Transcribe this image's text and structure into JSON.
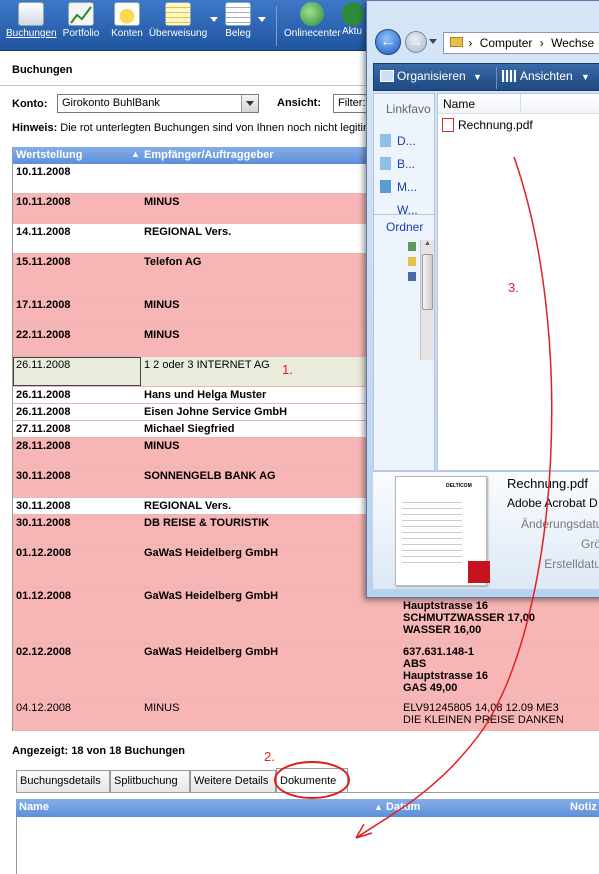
{
  "toolbar": {
    "buttons": [
      "Buchungen",
      "Portfolio",
      "Konten",
      "Überweisung",
      "Beleg",
      "Onlinecenter",
      "Aktu"
    ]
  },
  "page_title": "Buchungen",
  "konto": {
    "label": "Konto:",
    "value": "Girokonto BuhlBank"
  },
  "ansicht": {
    "label": "Ansicht:",
    "value": "Filter:"
  },
  "hint": {
    "label": "Hinweis:",
    "text": "Die rot unterlegten Buchungen sind von Ihnen noch nicht legitim"
  },
  "grid": {
    "col_wertstellung": "Wertstellung",
    "col_empfaenger": "Empfänger/Auftraggeber"
  },
  "rows": [
    {
      "date": "10.11.2008",
      "party": "",
      "extra": ""
    },
    {
      "date": "10.11.2008",
      "party": "MINUS",
      "extra": ""
    },
    {
      "date": "14.11.2008",
      "party": "REGIONAL Vers.",
      "extra": ""
    },
    {
      "date": "15.11.2008",
      "party": "Telefon AG",
      "extra": ""
    },
    {
      "date": "17.11.2008",
      "party": "MINUS",
      "extra": ""
    },
    {
      "date": "22.11.2008",
      "party": "MINUS",
      "extra": ""
    },
    {
      "date": "26.11.2008",
      "party": "1 2 oder 3 INTERNET AG",
      "extra": ""
    },
    {
      "date": "26.11.2008",
      "party": "Hans und Helga Muster",
      "extra": ""
    },
    {
      "date": "26.11.2008",
      "party": "Eisen Johne Service GmbH",
      "extra": ""
    },
    {
      "date": "27.11.2008",
      "party": "Michael Siegfried",
      "extra": ""
    },
    {
      "date": "28.11.2008",
      "party": "MINUS",
      "extra": ""
    },
    {
      "date": "30.11.2008",
      "party": "SONNENGELB BANK AG",
      "extra": ""
    },
    {
      "date": "30.11.2008",
      "party": "REGIONAL Vers.",
      "extra": ""
    },
    {
      "date": "30.11.2008",
      "party": "DB REISE & TOURISTIK",
      "extra": ""
    },
    {
      "date": "01.12.2008",
      "party": "GaWaS Heidelberg GmbH",
      "extra": ""
    },
    {
      "date": "01.12.2008",
      "party": "GaWaS Heidelberg GmbH",
      "extra": "Hauptstrasse 16\nSCHMUTZWASSER 17,00\nWASSER 16,00"
    },
    {
      "date": "02.12.2008",
      "party": "GaWaS Heidelberg GmbH",
      "extra": "637.631.148-1\nABS\nHauptstrasse 16\nGAS 49,00"
    },
    {
      "date": "04.12.2008",
      "party": "MINUS",
      "extra": "ELV91245805 14,08 12.09 ME3\nDIE KLEINEN PREISE DANKEN"
    }
  ],
  "status": "Angezeigt: 18 von 18 Buchungen",
  "tabs": [
    "Buchungsdetails",
    "Splitbuchung",
    "Weitere Details",
    "Dokumente"
  ],
  "doc_grid": {
    "col_name": "Name",
    "col_datum": "Datum",
    "col_notiz": "Notiz"
  },
  "annotations": {
    "n1": "1.",
    "n2": "2.",
    "n3": "3."
  },
  "explorer": {
    "address": [
      "Computer",
      "Wechse"
    ],
    "organize": "Organisieren",
    "views": "Ansichten",
    "fav_header": "Linkfavo",
    "favs": [
      "D...",
      "B...",
      "M...",
      "W..."
    ],
    "folders": "Ordner",
    "col_name": "Name",
    "file": "Rechnung.pdf",
    "detail_name": "Rechnung.pdf",
    "detail_type": "Adobe Acrobat D",
    "detail_fields": [
      "Änderungsdatu",
      "Grö",
      "Erstelldatu"
    ],
    "thumb_brand": "DELTICOM"
  },
  "colors": {
    "red_row": "#f8b5b5",
    "white_row": "#ffffff",
    "selected_row": "#ebebdc",
    "header_blue": "#5d8fd8",
    "annotation": "#e02020"
  }
}
